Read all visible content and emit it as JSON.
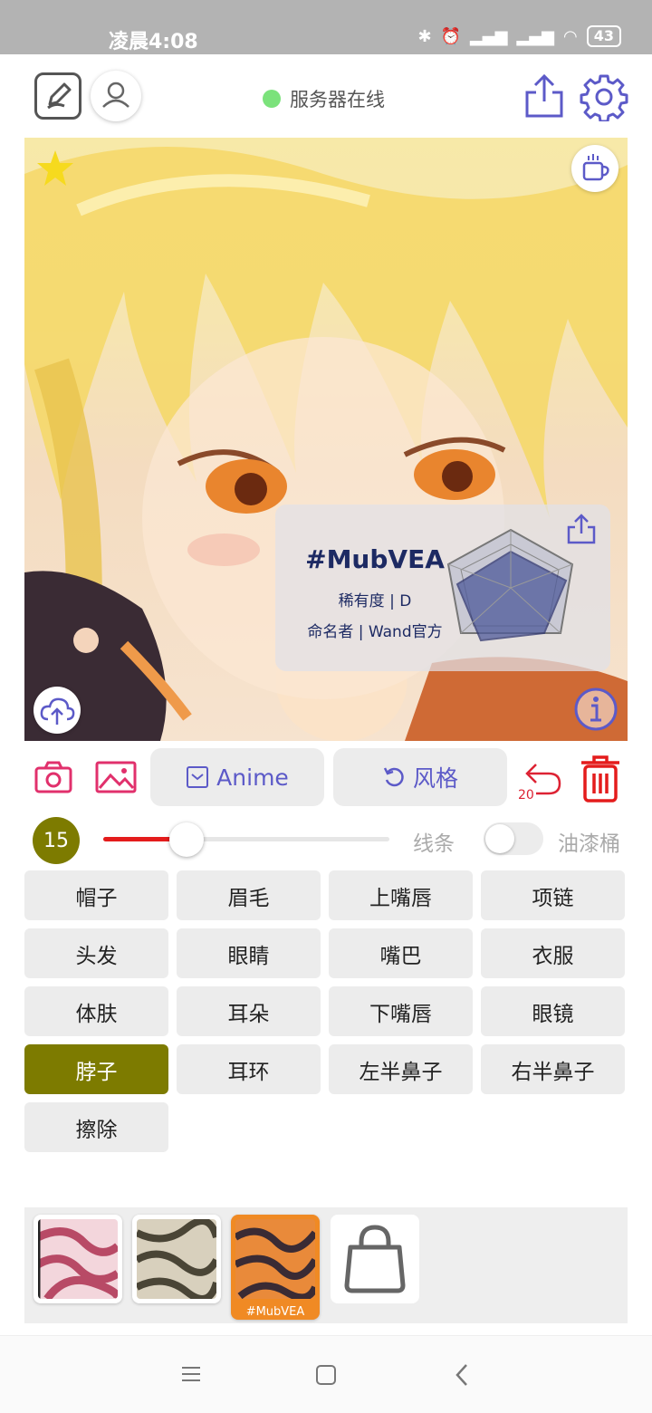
{
  "status_bar": {
    "time": "凌晨4:08",
    "battery": "43"
  },
  "header": {
    "server_status": "服务器在线"
  },
  "card": {
    "name": "#MubVEA",
    "rarity": "稀有度 | D",
    "namer": "命名者 | Wand官方"
  },
  "toolbar": {
    "anime_label": "Anime",
    "style_label": "风格",
    "undo_count": "20"
  },
  "brush": {
    "size": "15",
    "slider_value": 0.29,
    "line_label": "线条",
    "bucket_label": "油漆桶",
    "bucket_enabled": false
  },
  "parts": [
    {
      "label": "帽子",
      "active": false
    },
    {
      "label": "眉毛",
      "active": false
    },
    {
      "label": "上嘴唇",
      "active": false
    },
    {
      "label": "项链",
      "active": false
    },
    {
      "label": "头发",
      "active": false
    },
    {
      "label": "眼睛",
      "active": false
    },
    {
      "label": "嘴巴",
      "active": false
    },
    {
      "label": "衣服",
      "active": false
    },
    {
      "label": "体肤",
      "active": false
    },
    {
      "label": "耳朵",
      "active": false
    },
    {
      "label": "下嘴唇",
      "active": false
    },
    {
      "label": "眼镜",
      "active": false
    },
    {
      "label": "脖子",
      "active": true
    },
    {
      "label": "耳环",
      "active": false
    },
    {
      "label": "左半鼻子",
      "active": false
    },
    {
      "label": "右半鼻子",
      "active": false
    },
    {
      "label": "擦除",
      "active": false
    }
  ],
  "patterns": [
    {
      "name": "",
      "color": "#b84a66",
      "selected": false
    },
    {
      "name": "",
      "color": "#7c735e",
      "selected": false
    },
    {
      "name": "#MubVEA",
      "color": "#e98a3a",
      "selected": true
    }
  ],
  "colors": {
    "accent": "#5c5ac8",
    "active_part": "#7d7b00",
    "danger": "#e41c1c",
    "server_online": "#7be27b"
  }
}
